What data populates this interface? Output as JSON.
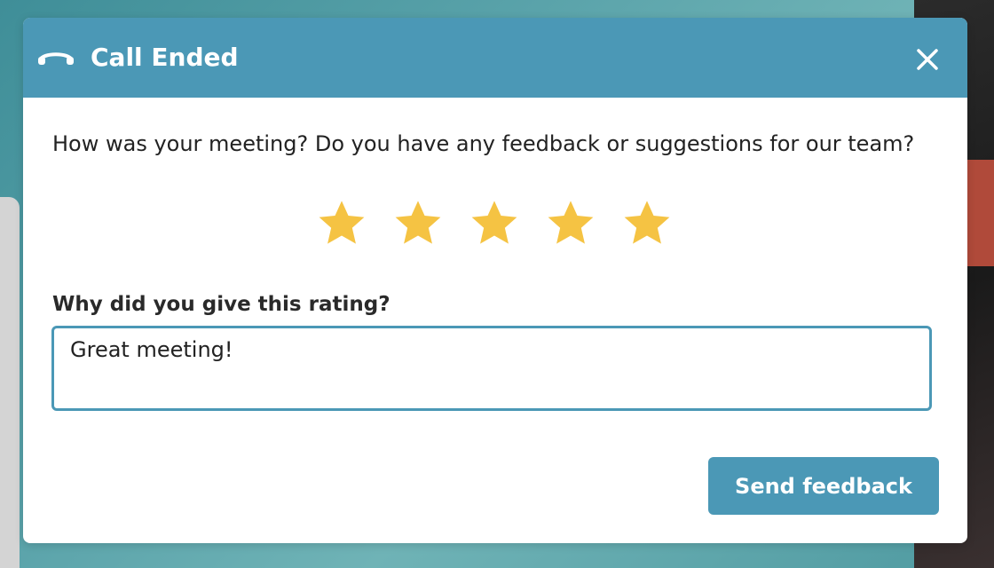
{
  "dialog": {
    "title": "Call Ended",
    "question": "How was your meeting? Do you have any feedback or suggestions for our team?",
    "rating": {
      "value": 5,
      "max": 5,
      "star_color": "#f5c343"
    },
    "reason_label": "Why did you give this rating?",
    "reason_value": "Great meeting!",
    "send_label": "Send feedback"
  },
  "colors": {
    "header": "#4b98b6",
    "accent": "#4b98b6"
  },
  "icons": {
    "header_icon": "phone-hangup-icon",
    "close_icon": "close-icon",
    "star_icon": "star-icon"
  }
}
